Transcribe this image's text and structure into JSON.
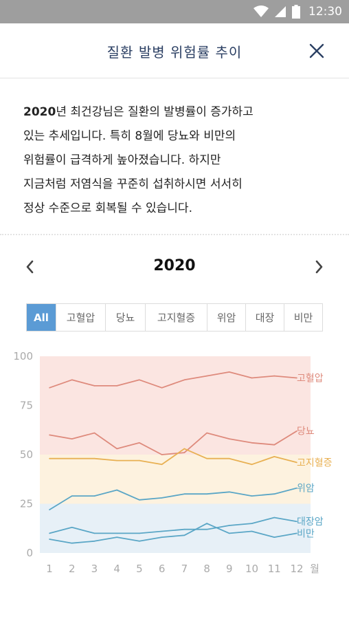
{
  "status": {
    "time": "12:30"
  },
  "header": {
    "title": "질환 발병 위험률 추이"
  },
  "description": {
    "year": "2020",
    "lines": [
      "년 최건강님은 질환의 발병률이 증가하고",
      "있는 추세입니다. 특히 8월에 당뇨와 비만의",
      "위험률이 급격하게 높아졌습니다. 하지만",
      "지금처럼 저염식을 꾸준히 섭취하시면 서서히",
      "정상 수준으로 회복될 수 있습니다."
    ]
  },
  "year_nav": {
    "year": "2020"
  },
  "tabs": [
    "All",
    "고혈압",
    "당뇨",
    "고지혈증",
    "위암",
    "대장",
    "비만"
  ],
  "active_tab": "All",
  "colors": {
    "band_high": "#fbe5e1",
    "band_mid": "#fdf2df",
    "band_low": "#e7f0f7",
    "hypertension": "#de8a7c",
    "diabetes": "#de8a7c",
    "hyperlipidemia": "#e8b052",
    "blue": "#5aa6c6"
  },
  "chart_data": {
    "type": "line",
    "x": [
      1,
      2,
      3,
      4,
      5,
      6,
      7,
      8,
      9,
      10,
      11,
      12
    ],
    "x_unit": "월",
    "ylim": [
      0,
      100
    ],
    "yticks": [
      0,
      25,
      50,
      75,
      100
    ],
    "grid": false,
    "bands": [
      {
        "from": 50,
        "to": 100,
        "color": "#fbe5e1"
      },
      {
        "from": 25,
        "to": 50,
        "color": "#fdf2df"
      },
      {
        "from": 0,
        "to": 25,
        "color": "#e7f0f7"
      }
    ],
    "series": [
      {
        "name": "고혈압",
        "color": "#de8a7c",
        "values": [
          84,
          88,
          85,
          85,
          88,
          84,
          88,
          90,
          92,
          89,
          90,
          89
        ]
      },
      {
        "name": "당뇨",
        "color": "#de8a7c",
        "values": [
          60,
          58,
          61,
          53,
          56,
          50,
          51,
          61,
          58,
          56,
          55,
          62
        ]
      },
      {
        "name": "고지혈증",
        "color": "#e8b052",
        "values": [
          48,
          48,
          48,
          47,
          47,
          45,
          53,
          48,
          48,
          45,
          49,
          46
        ]
      },
      {
        "name": "위암",
        "color": "#5aa6c6",
        "values": [
          22,
          29,
          29,
          32,
          27,
          28,
          30,
          30,
          31,
          29,
          30,
          33
        ]
      },
      {
        "name": "대장암",
        "color": "#5aa6c6",
        "values": [
          10,
          13,
          10,
          10,
          10,
          11,
          12,
          12,
          14,
          15,
          18,
          16
        ]
      },
      {
        "name": "비만",
        "color": "#5aa6c6",
        "values": [
          7,
          5,
          6,
          8,
          6,
          8,
          9,
          15,
          10,
          11,
          8,
          10
        ]
      }
    ]
  }
}
